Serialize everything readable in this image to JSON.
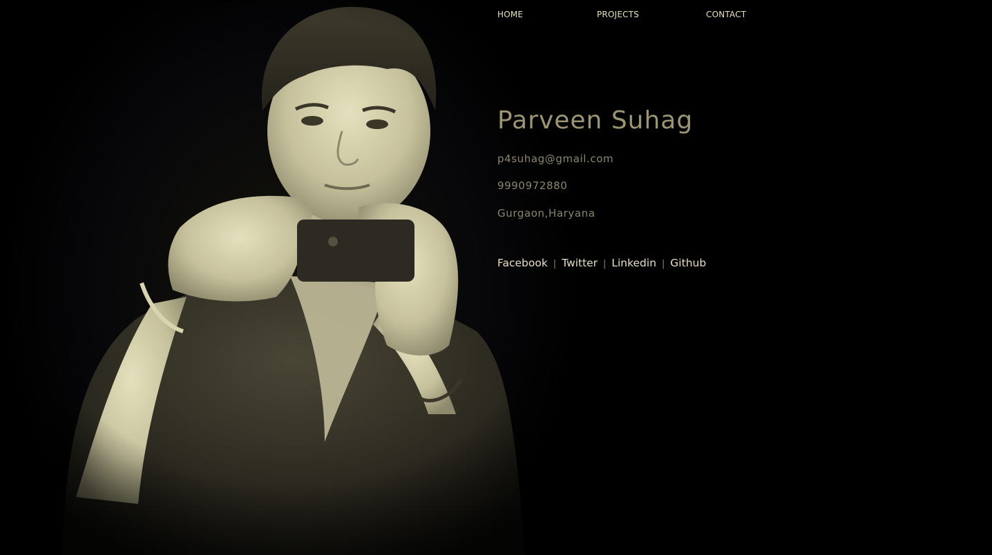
{
  "nav": {
    "home": "HOME",
    "projects": "PROJECTS",
    "contact": "CONTACT"
  },
  "profile": {
    "name": "Parveen Suhag",
    "email": "p4suhag@gmail.com",
    "phone": "9990972880",
    "location": "Gurgaon,Haryana"
  },
  "social": {
    "separator": "|",
    "facebook": "Facebook",
    "twitter": "Twitter",
    "linkedin": "Linkedin",
    "github": "Github"
  },
  "colors": {
    "background": "#000000",
    "nav_text": "#e8e2b8",
    "name_text": "#9c9670",
    "detail_text": "#8c876a",
    "social_link": "#e6e0c0",
    "separator": "#8c876a",
    "photo_tone_light": "#d8d4b0",
    "photo_tone_dark": "#2a2820"
  }
}
